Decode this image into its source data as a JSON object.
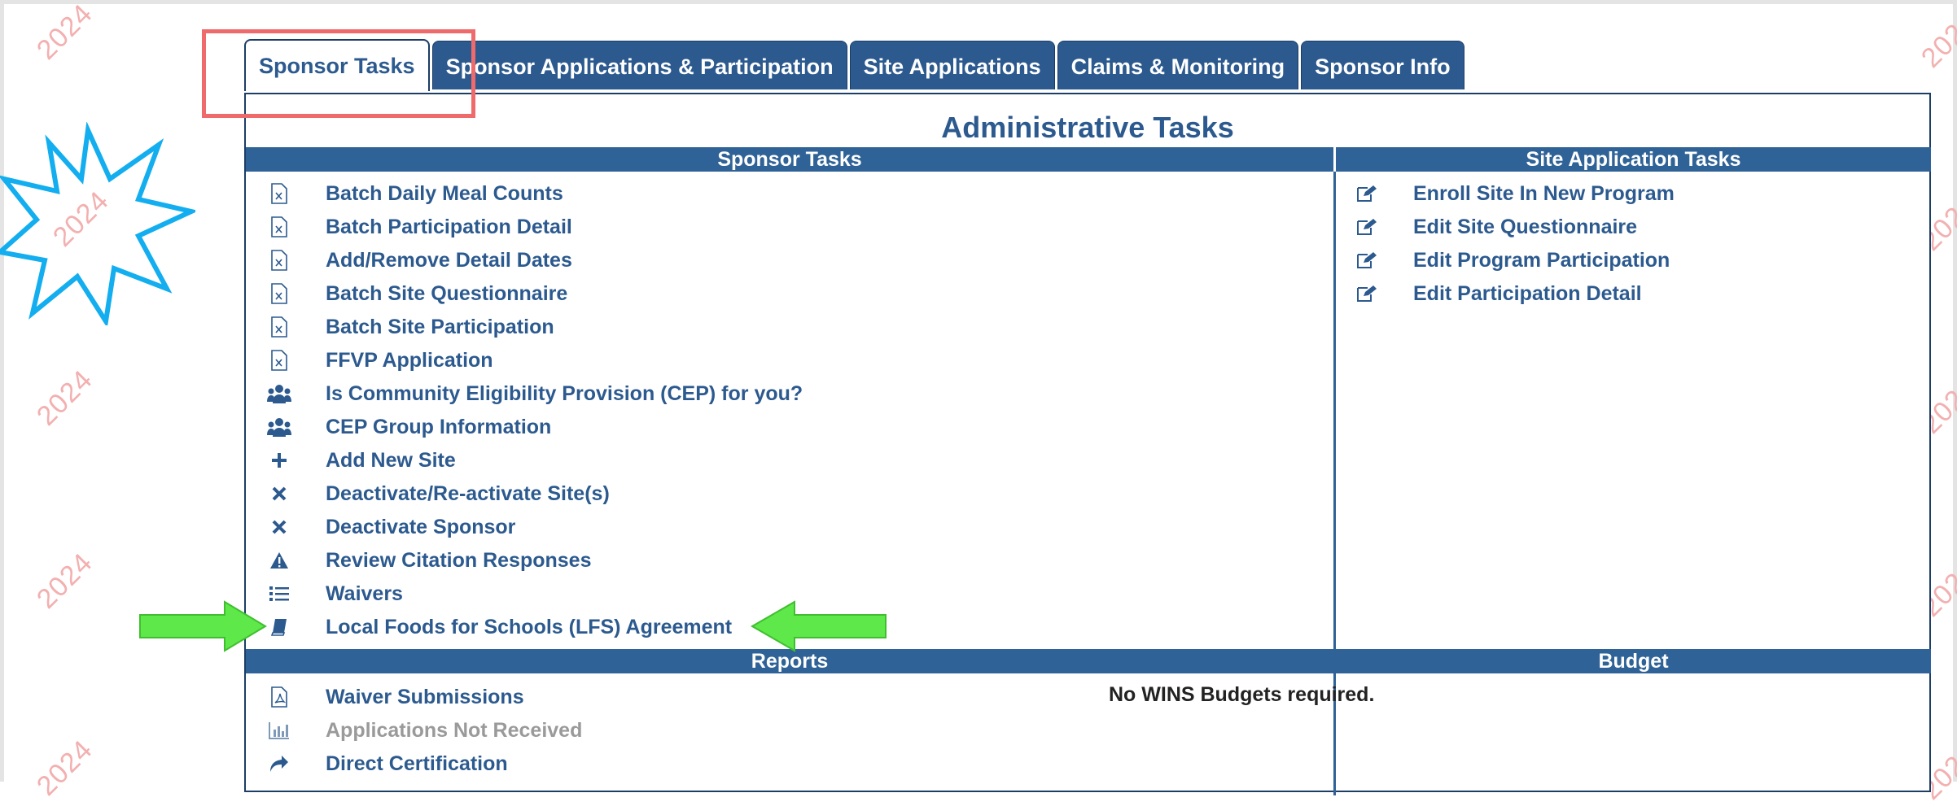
{
  "watermark": "2024",
  "tabs": [
    {
      "label": "Sponsor Tasks",
      "active": true
    },
    {
      "label": "Sponsor Applications & Participation"
    },
    {
      "label": "Site Applications"
    },
    {
      "label": "Claims & Monitoring"
    },
    {
      "label": "Sponsor Info"
    }
  ],
  "panel": {
    "title": "Administrative Tasks"
  },
  "sponsor_tasks": {
    "header": "Sponsor Tasks",
    "items": [
      {
        "label": "Batch Daily Meal Counts",
        "icon": "excel-file-icon"
      },
      {
        "label": "Batch Participation Detail",
        "icon": "excel-file-icon"
      },
      {
        "label": "Add/Remove Detail Dates",
        "icon": "excel-file-icon"
      },
      {
        "label": "Batch Site Questionnaire",
        "icon": "excel-file-icon"
      },
      {
        "label": "Batch Site Participation",
        "icon": "excel-file-icon"
      },
      {
        "label": "FFVP Application",
        "icon": "excel-file-icon"
      },
      {
        "label": "Is Community Eligibility Provision (CEP) for you?",
        "icon": "users-icon"
      },
      {
        "label": "CEP Group Information",
        "icon": "users-icon"
      },
      {
        "label": "Add New Site",
        "icon": "plus-icon"
      },
      {
        "label": "Deactivate/Re-activate Site(s)",
        "icon": "close-icon"
      },
      {
        "label": "Deactivate Sponsor",
        "icon": "close-icon"
      },
      {
        "label": "Review Citation Responses",
        "icon": "warning-icon"
      },
      {
        "label": "Waivers",
        "icon": "list-icon"
      },
      {
        "label": "Local Foods for Schools (LFS) Agreement",
        "icon": "book-icon"
      }
    ]
  },
  "site_tasks": {
    "header": "Site Application Tasks",
    "items": [
      {
        "label": "Enroll Site In New Program",
        "icon": "edit-icon"
      },
      {
        "label": "Edit Site Questionnaire",
        "icon": "edit-icon"
      },
      {
        "label": "Edit Program Participation",
        "icon": "edit-icon"
      },
      {
        "label": "Edit Participation Detail",
        "icon": "edit-icon"
      }
    ]
  },
  "reports": {
    "header": "Reports",
    "items": [
      {
        "label": "Waiver Submissions",
        "icon": "pdf-file-icon",
        "enabled": true
      },
      {
        "label": "Applications Not Received",
        "icon": "bar-chart-icon",
        "enabled": false
      },
      {
        "label": "Direct Certification",
        "icon": "share-arrow-icon",
        "enabled": true
      }
    ]
  },
  "budget": {
    "header": "Budget",
    "message": "No WINS Budgets required."
  },
  "colors": {
    "brand_blue": "#2c5a8f",
    "header_bar": "#2f6296",
    "callout_red": "#ef6b6b",
    "callout_green": "#5ee84a",
    "burst_cyan": "#13aeef"
  }
}
